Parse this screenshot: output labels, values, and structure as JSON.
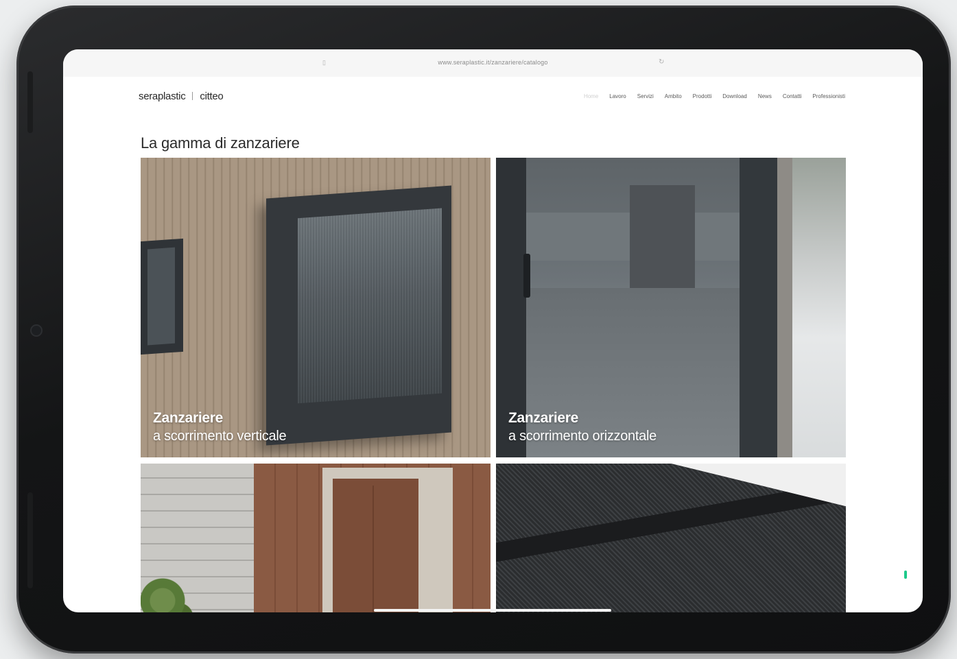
{
  "browser": {
    "url": "www.seraplastic.it/zanzariere/catalogo"
  },
  "header": {
    "logo_primary": "seraplastic",
    "logo_secondary": "citteo",
    "nav": [
      {
        "label": "Home"
      },
      {
        "label": "Lavoro"
      },
      {
        "label": "Servizi"
      },
      {
        "label": "Ambito"
      },
      {
        "label": "Prodotti"
      },
      {
        "label": "Download"
      },
      {
        "label": "News"
      },
      {
        "label": "Contatti"
      },
      {
        "label": "Professionisti"
      }
    ]
  },
  "main": {
    "title": "La gamma di zanzariere",
    "cards": [
      {
        "title": "Zanzariere",
        "subtitle": "a scorrimento verticale"
      },
      {
        "title": "Zanzariere",
        "subtitle": "a scorrimento orizzontale"
      },
      {
        "title": "",
        "subtitle": ""
      },
      {
        "title": "",
        "subtitle": ""
      }
    ]
  },
  "colors": {
    "accent": "#1cc98a",
    "device": "#141516",
    "text": "#2b2b2b"
  }
}
